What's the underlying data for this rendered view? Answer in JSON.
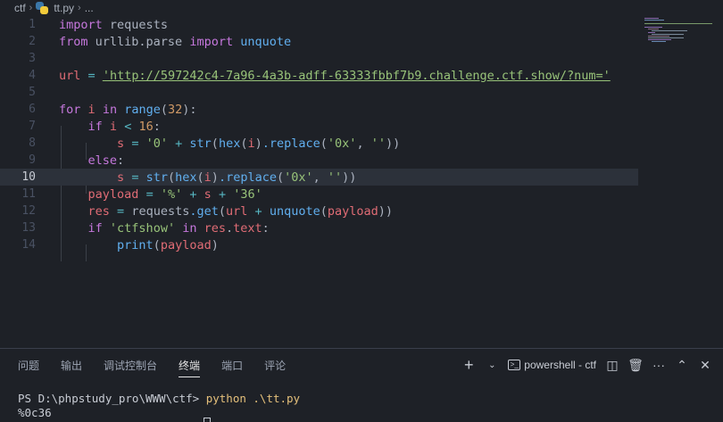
{
  "breadcrumb": {
    "folder": "ctf",
    "file": "tt.py",
    "tail": "..."
  },
  "editor": {
    "current_line": 10,
    "lines": [
      {
        "n": "1"
      },
      {
        "n": "2"
      },
      {
        "n": "3"
      },
      {
        "n": "4"
      },
      {
        "n": "5"
      },
      {
        "n": "6"
      },
      {
        "n": "7"
      },
      {
        "n": "8"
      },
      {
        "n": "9"
      },
      {
        "n": "10"
      },
      {
        "n": "11"
      },
      {
        "n": "12"
      },
      {
        "n": "13"
      },
      {
        "n": "14"
      }
    ],
    "tokens": {
      "import": "import",
      "requests": "requests",
      "from": "from",
      "urllib_parse": "urllib.parse",
      "unquote": "unquote",
      "url": "url",
      "eq": "=",
      "url_value": "'http://597242c4-7a96-4a3b-adff-63333fbbf7b9.challenge.ctf.show/?num='",
      "for": "for",
      "i": "i",
      "in": "in",
      "range": "range",
      "lp": "(",
      "rp": ")",
      "n32": "32",
      "colon": ":",
      "if": "if",
      "lt": "<",
      "n16": "16",
      "s": "s",
      "str0": "'0'",
      "plus": "+",
      "str": "str",
      "hex": "hex",
      "replace": ".replace",
      "str0x": "'0x'",
      "comma": ",",
      "empty": "''",
      "else": "else",
      "payload": "payload",
      "pct": "'%'",
      "s36": "'36'",
      "res": "res",
      "get": ".get",
      "dot": ".",
      "ctfshow": "'ctfshow'",
      "text": "text",
      "print": "print",
      "close2": "))"
    }
  },
  "panel": {
    "tabs": [
      "问题",
      "输出",
      "调试控制台",
      "终端",
      "端口",
      "评论"
    ],
    "active_tab": "终端",
    "terminal_name": "powershell - ctf",
    "prompt": "PS D:\\phpstudy_pro\\WWW\\ctf> ",
    "command": "python .\\tt.py",
    "output": "%0c36"
  }
}
